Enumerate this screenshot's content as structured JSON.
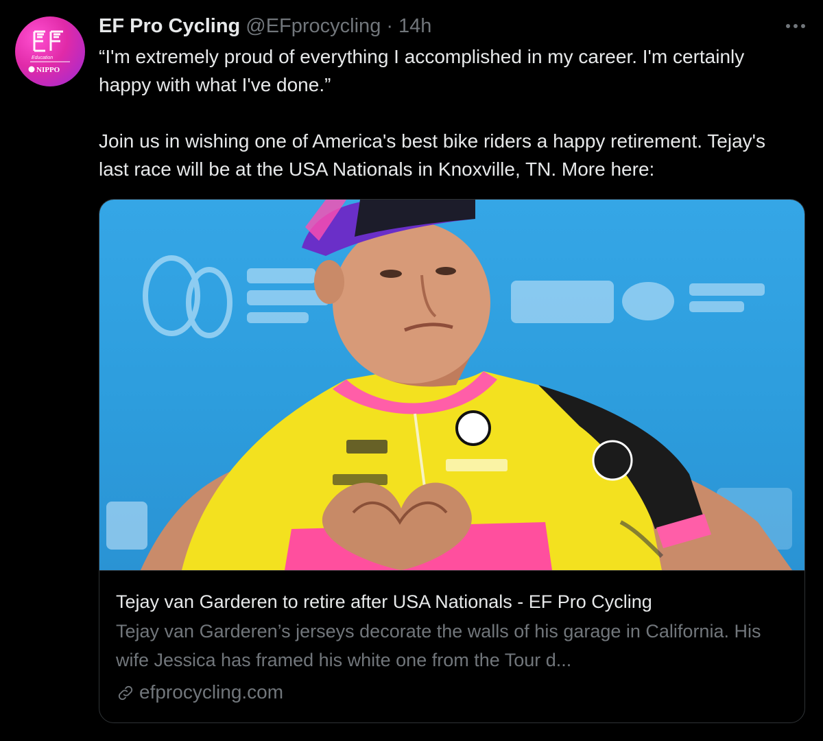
{
  "tweet": {
    "author": {
      "display_name": "EF Pro Cycling",
      "handle": "@EFprocycling",
      "avatar_icon": "ef-education-nippo-logo",
      "avatar_text_top": "Education",
      "avatar_text_bottom": "NIPPO"
    },
    "separator": "·",
    "timestamp": "14h",
    "more_icon": "more-horizontal-icon",
    "text": "“I'm extremely proud of everything I accomplished in my career. I'm certainly happy with what I've done.”\n\nJoin us in wishing one of America's best bike riders a happy retirement. Tejay's last race will be at the USA Nationals in Knoxville, TN. More here:",
    "card": {
      "image_icon": "cyclist-heart-hands-photo",
      "title": "Tejay van Garderen to retire after USA Nationals - EF Pro Cycling",
      "description": "Tejay van Garderen’s jerseys decorate the walls of his garage in California. His wife Jessica has framed his white one from the Tour d...",
      "domain_icon": "link-icon",
      "domain": "efprocycling.com"
    }
  },
  "colors": {
    "background": "#000000",
    "primary_text": "#e7e9ea",
    "secondary_text": "#71767b",
    "border": "#2f3336",
    "avatar_pink": "#e02aa8",
    "jersey_yellow": "#f3e11f",
    "jersey_pink": "#ff5ea8",
    "backdrop_blue": "#2d9ddd"
  }
}
